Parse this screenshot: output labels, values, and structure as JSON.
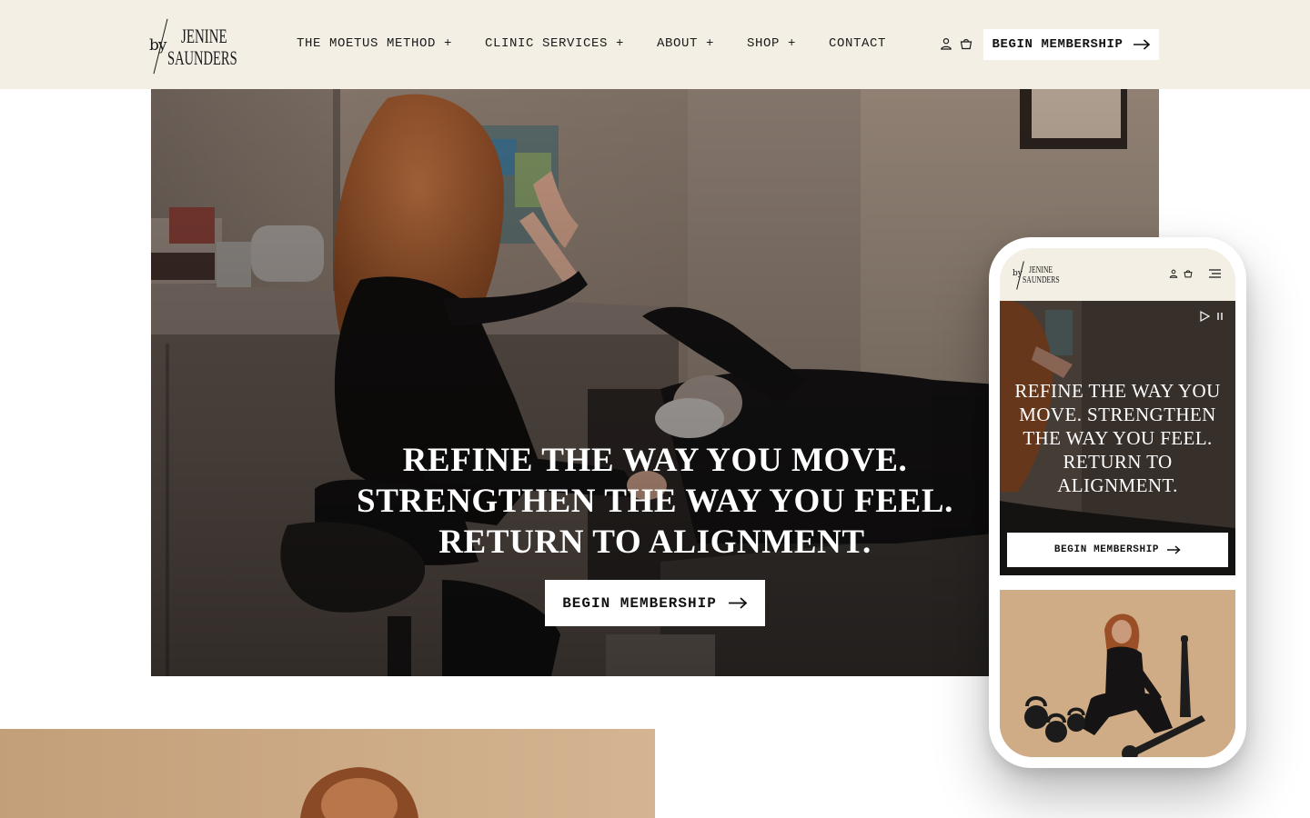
{
  "brand": {
    "by": "by",
    "line1": "JENINE",
    "line2": "SAUNDERS"
  },
  "nav": {
    "items": [
      {
        "label": "THE MOETUS METHOD +"
      },
      {
        "label": "CLINIC SERVICES +"
      },
      {
        "label": "ABOUT +"
      },
      {
        "label": "SHOP +"
      },
      {
        "label": "CONTACT"
      }
    ],
    "account_icon": "user-icon",
    "cart_icon": "basket-icon",
    "cta_label": "BEGIN MEMBERSHIP"
  },
  "hero": {
    "title_lines": [
      "REFINE THE WAY YOU MOVE.",
      "STRENGTHEN THE WAY YOU FEEL.",
      "RETURN TO ALIGNMENT."
    ],
    "cta_label": "BEGIN MEMBERSHIP"
  },
  "mobile": {
    "title": "REFINE THE WAY YOU MOVE. STRENGTHEN THE WAY YOU FEEL. RETURN TO ALIGNMENT.",
    "cta_label": "BEGIN MEMBERSHIP",
    "icons": [
      "user-icon",
      "basket-icon",
      "menu-icon",
      "play-icon",
      "pause-icon"
    ]
  },
  "colors": {
    "header_bg": "#f3efe4",
    "button_bg": "#ffffff",
    "hero_text": "#ffffff",
    "ink": "#1a1a1a"
  }
}
